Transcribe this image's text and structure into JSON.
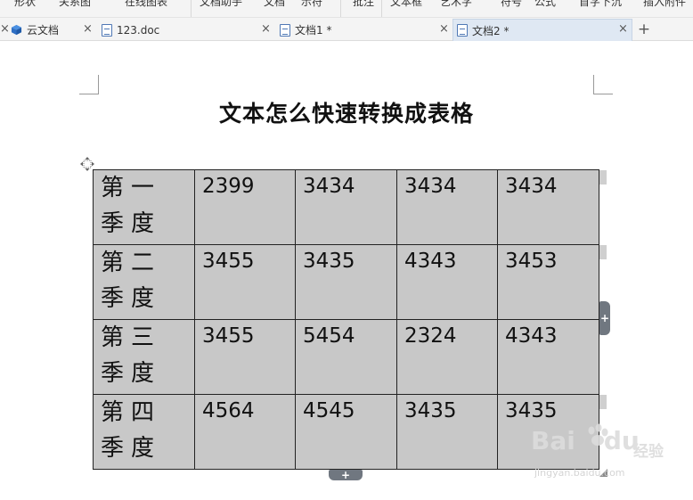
{
  "ribbon": {
    "items": [
      "形状",
      "关系图",
      "在线图表",
      "文档助手",
      "文档",
      "示符",
      "批注",
      "文本框",
      "艺术字",
      "符号",
      "公式",
      "首字下沉",
      "插入附件"
    ]
  },
  "tabs": [
    {
      "label": "云文档",
      "icon": "cloud-doc-icon"
    },
    {
      "label": "123.doc",
      "icon": "doc-icon"
    },
    {
      "label": "文档1 *",
      "icon": "doc-icon"
    },
    {
      "label": "文档2 *",
      "icon": "doc-icon",
      "active": true
    }
  ],
  "tab_close_glyph": "×",
  "add_tab_glyph": "+",
  "document": {
    "title": "文本怎么快速转换成表格",
    "table": {
      "rows": [
        {
          "label": "第一季度",
          "values": [
            "2399",
            "3434",
            "3434",
            "3434"
          ]
        },
        {
          "label": "第二季度",
          "values": [
            "3455",
            "3435",
            "4343",
            "3453"
          ]
        },
        {
          "label": "第三季度",
          "values": [
            "3455",
            "5454",
            "2324",
            "4343"
          ]
        },
        {
          "label": "第四季度",
          "values": [
            "4564",
            "4545",
            "3435",
            "3435"
          ]
        }
      ],
      "fill_color": "#c8c8c8"
    },
    "add_glyph": "+"
  },
  "watermark": {
    "brand": "Bai",
    "brand2": "du",
    "sub": "经验",
    "url": "jingyan.baidu.com"
  },
  "colors": {
    "accent": "#4f78b5",
    "active_tab": "#dfe8f3",
    "handle": "#707780"
  }
}
